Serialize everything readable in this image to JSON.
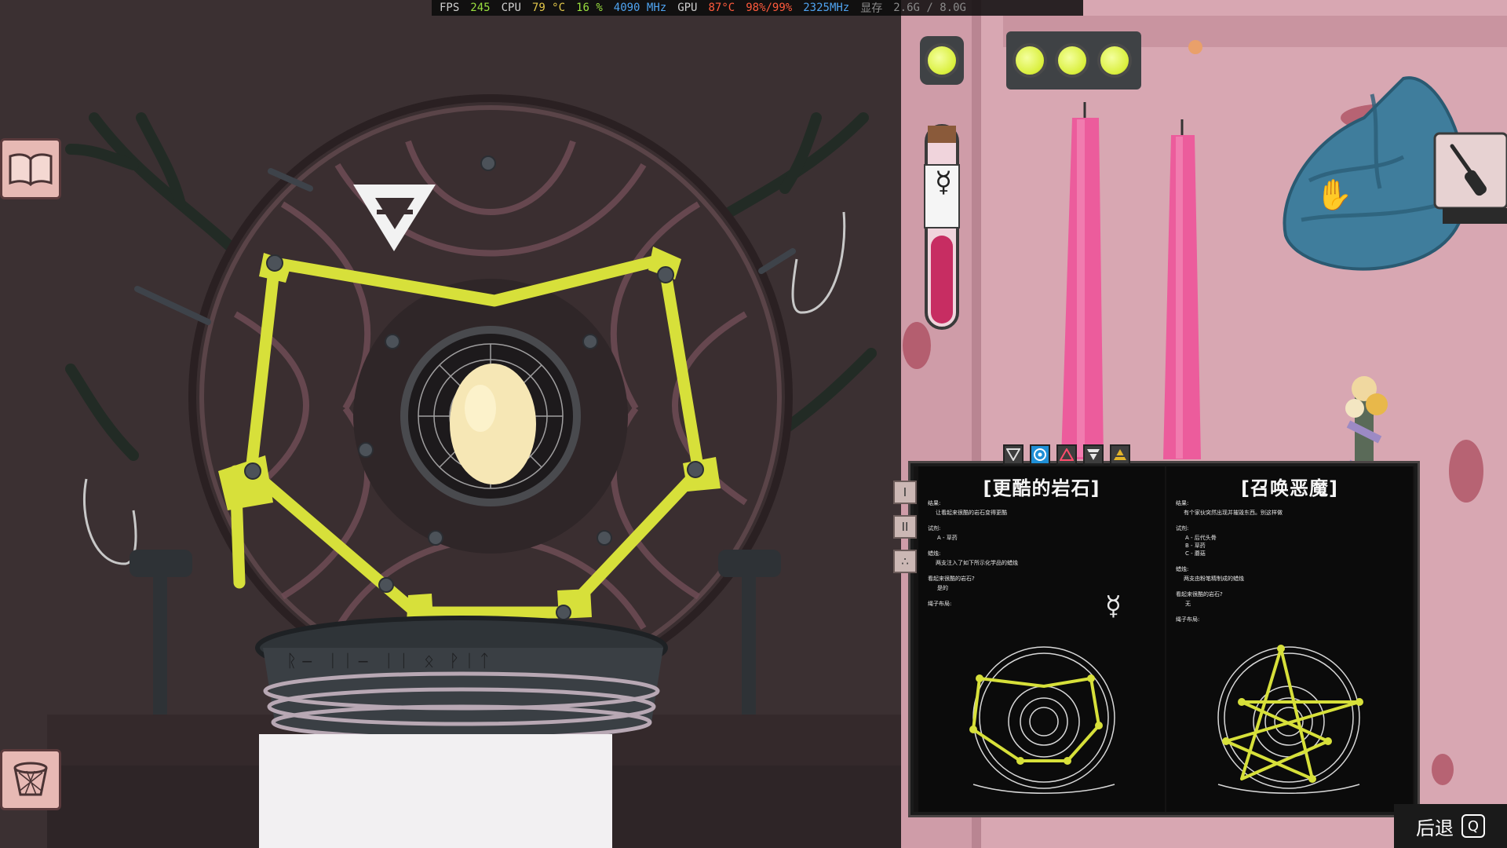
{
  "perf_overlay": {
    "fps_label": "FPS",
    "fps_value": "245",
    "cpu_label": "CPU",
    "cpu_temp": "79 °C",
    "cpu_usage": "16 %",
    "cpu_clock": "4090 MHz",
    "gpu_label": "GPU",
    "gpu_temp": "87°C",
    "gpu_usage": "98%/99%",
    "gpu_clock": "2325MHz",
    "vram_label": "显存",
    "vram_value": "2.6G / 8.0G"
  },
  "left_panel": {
    "book_button_icon": "open-book-icon",
    "trash_button_icon": "waste-basket-icon",
    "ritual_symbol_icon": "water-triangle-icon",
    "rune_altar_text": "ᚱ‒ ᛁᛁ‒ ᛁᛁ ᛟ ᚹᛁᛏ"
  },
  "right_panel": {
    "indicator_lights": 4,
    "screwdriver_icon": "screwdriver-icon",
    "cursor_icon": "grab-hand-icon",
    "vial_symbol_icon": "mercury-symbol-icon"
  },
  "recipe_book": {
    "element_tabs": [
      "water-icon",
      "earth-icon",
      "fire-icon",
      "air-icon",
      "aether-icon"
    ],
    "side_tabs": [
      "I",
      "II",
      "∴"
    ],
    "left_page": {
      "title": "[更酷的岩石]",
      "result_label": "结果:",
      "result_text": "让看起来很酷的岩石变得更酷",
      "reagents_label": "试剂:",
      "reagents": [
        "A - 草药"
      ],
      "candles_label": "蜡烛:",
      "candles_text": "两支注入了如下所示化学品的蜡烛",
      "cool_rock_label": "看起来很酷的岩石?",
      "cool_rock_value": "是的",
      "rope_label": "绳子布局:"
    },
    "right_page": {
      "title": "[召唤恶魔]",
      "result_label": "结果:",
      "result_text": "有个家伙突然出现并摧毁东西。别这样做",
      "reagents_label": "试剂:",
      "reagents": [
        "A - 后代头骨",
        "B - 草药",
        "C - 蘑菇"
      ],
      "candles_label": "蜡烛:",
      "candles_text": "两支由粉笔精制成的蜡烛",
      "cool_rock_label": "看起来很酷的岩石?",
      "cool_rock_value": "无",
      "rope_label": "绳子布局:"
    }
  },
  "back_button": {
    "label": "后退",
    "key": "Q"
  },
  "colors": {
    "rope": "#d7e03a",
    "candle": "#ec5c9c",
    "rock": "#3f7d9c",
    "wall": "#d7a6b0"
  }
}
